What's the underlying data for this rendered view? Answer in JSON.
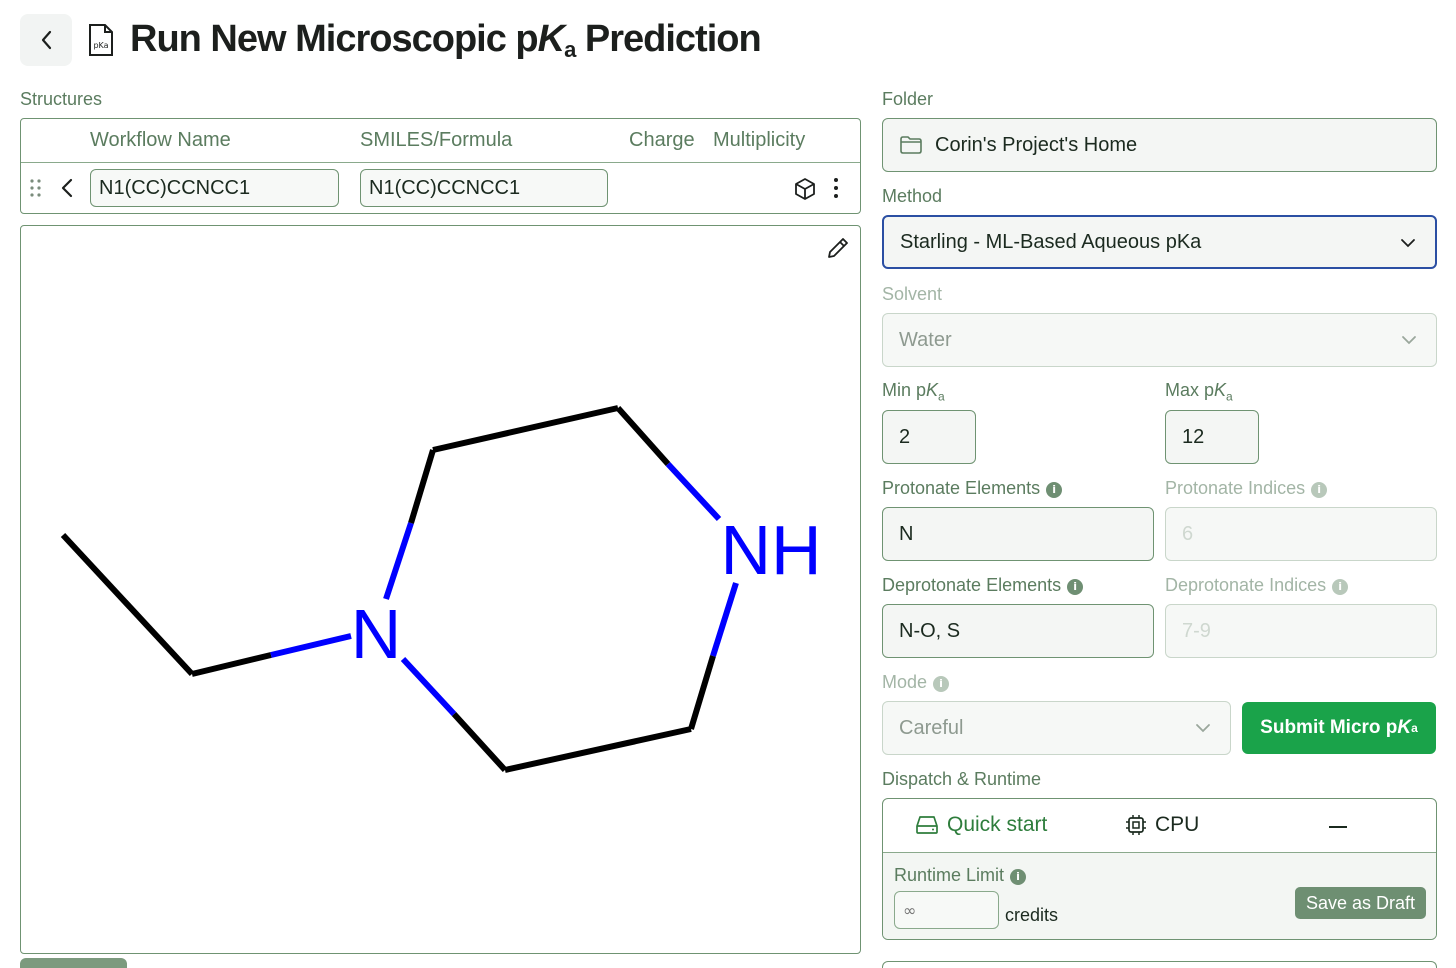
{
  "header": {
    "title_prefix": "Run New Microscopic p",
    "title_k": "K",
    "title_sub": "a",
    "title_suffix": " Prediction",
    "doc_icon_text": "pKa"
  },
  "structures": {
    "label": "Structures",
    "columns": {
      "workflow_name": "Workflow Name",
      "smiles": "SMILES/Formula",
      "charge": "Charge",
      "multiplicity": "Multiplicity"
    },
    "row": {
      "workflow_name": "N1(CC)CCNCC1",
      "smiles": "N1(CC)CCNCC1"
    }
  },
  "molecule": {
    "atom_n1": "N",
    "atom_nh": "NH"
  },
  "folder": {
    "label": "Folder",
    "value": "Corin's Project's Home"
  },
  "method": {
    "label": "Method",
    "value": "Starling - ML-Based Aqueous pKa"
  },
  "solvent": {
    "label": "Solvent",
    "value": "Water"
  },
  "min_pka": {
    "label_prefix": "Min p",
    "label_k": "K",
    "label_sub": "a",
    "value": "2"
  },
  "max_pka": {
    "label_prefix": "Max p",
    "label_k": "K",
    "label_sub": "a",
    "value": "12"
  },
  "protonate_elements": {
    "label": "Protonate Elements",
    "value": "N"
  },
  "protonate_indices": {
    "label": "Protonate Indices",
    "placeholder": "6"
  },
  "deprotonate_elements": {
    "label": "Deprotonate Elements",
    "value": "N-O, S"
  },
  "deprotonate_indices": {
    "label": "Deprotonate Indices",
    "placeholder": "7-9"
  },
  "mode": {
    "label": "Mode",
    "value": "Careful"
  },
  "submit": {
    "label_prefix": "Submit Micro p",
    "label_k": "K",
    "label_sub": "a"
  },
  "dispatch": {
    "label": "Dispatch & Runtime",
    "quick_start": "Quick start",
    "cpu": "CPU",
    "runtime_limit_label": "Runtime Limit",
    "runtime_placeholder": "∞",
    "credits": "credits",
    "save_draft": "Save as Draft"
  },
  "colors": {
    "accent_green": "#1aa34a",
    "label_green": "#5b7c5f",
    "border_green": "#6f9372",
    "focus_blue": "#2b4fa3",
    "atom_blue": "#0000ff"
  }
}
